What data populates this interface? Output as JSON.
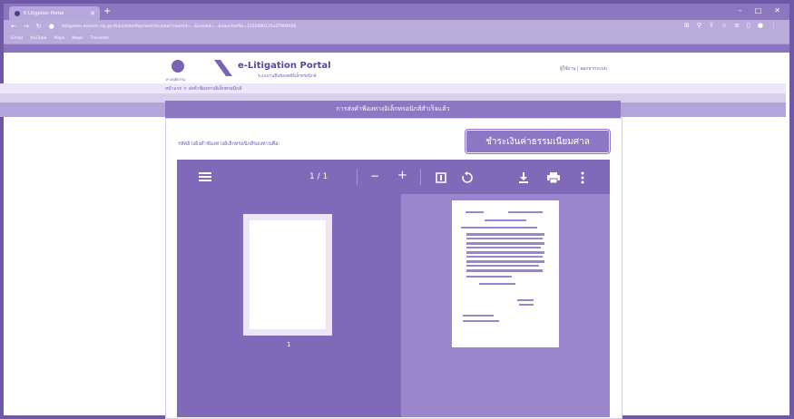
{
  "browser": {
    "tab_title": "E-Litigation Portal",
    "url": "elitigation.ecourts.coj.go.th/portal/ePayment/Voucher?courtId=...&caseId=...&voucherNo=1522080135e37994006",
    "bookmarks": [
      "Gmail",
      "YouTube",
      "Maps",
      "News",
      "Translate"
    ]
  },
  "site": {
    "org_caption": "ศาลยุติธรรม",
    "portal_title": "e-Litigation Portal",
    "portal_subtitle": "ระบบงานยื่นฟ้องคดีอิเล็กทรอนิกส์",
    "user_links": "ผู้ใช้งาน | ออกจากระบบ",
    "breadcrumb": "หน้าแรก > ส่งคำฟ้องทางอิเล็กทรอนิกส์",
    "page_title": "การส่งคำฟ้องทางอิเล็กทรอนิกส์สำเร็จแล้ว",
    "instruction": "รหัสอ้างอิงคำฟ้องทางอิเล็กทรอนิกส์ของท่านคือ:",
    "pay_button": "ชำระเงินค่าธรรมเนียมศาล"
  },
  "viewer": {
    "page_indicator": "1 / 1",
    "thumbnail_label": "1",
    "icons": [
      "menu-icon",
      "zoom-out-icon",
      "zoom-in-icon",
      "fit-page-icon",
      "rotate-icon",
      "download-icon",
      "print-icon",
      "more-icon"
    ]
  },
  "colors": {
    "accent": "#8d77c4",
    "frame": "#6f58a8",
    "viewer": "#8069b8"
  }
}
